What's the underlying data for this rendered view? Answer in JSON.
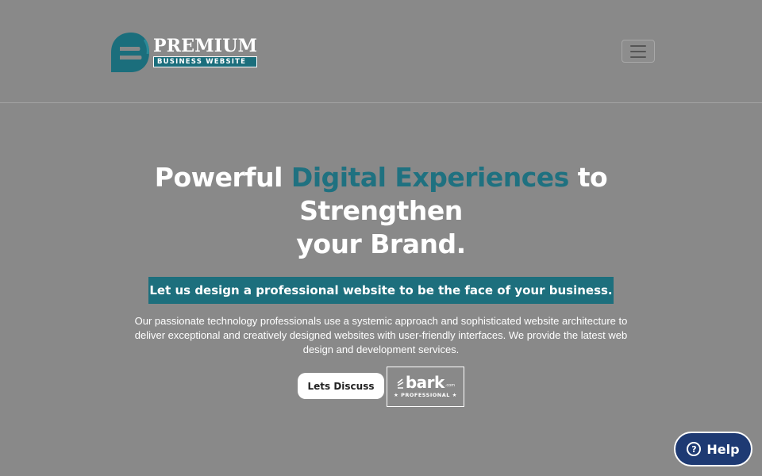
{
  "header": {
    "logo": {
      "title": "PREMIUM",
      "subtitle": "BUSINESS WEBSITE",
      "mark_icon": "e-logo-icon"
    },
    "menu_toggle": {
      "icon": "hamburger-menu-icon"
    }
  },
  "hero": {
    "title_part1": "Powerful ",
    "title_accent": "Digital Experiences",
    "title_part2": " to Strengthen",
    "title_part3": "your Brand.",
    "tagline": "Let us design a professional website to be the face of your business.",
    "description": "Our passionate technology professionals use a systemic approach and sophisticated website architecture to deliver exceptional and creatively designed websites with user-friendly interfaces. We provide the latest web design and development services.",
    "cta_label": "Lets Discuss",
    "badge": {
      "name": "bark",
      "domain": ".com",
      "label": "★ PROFESSIONAL ★"
    }
  },
  "help_widget": {
    "label": "Help",
    "icon": "question-circle-icon",
    "icon_glyph": "?"
  },
  "colors": {
    "background": "#898989",
    "accent": "#1f7180",
    "help_button": "#1e3a73"
  }
}
